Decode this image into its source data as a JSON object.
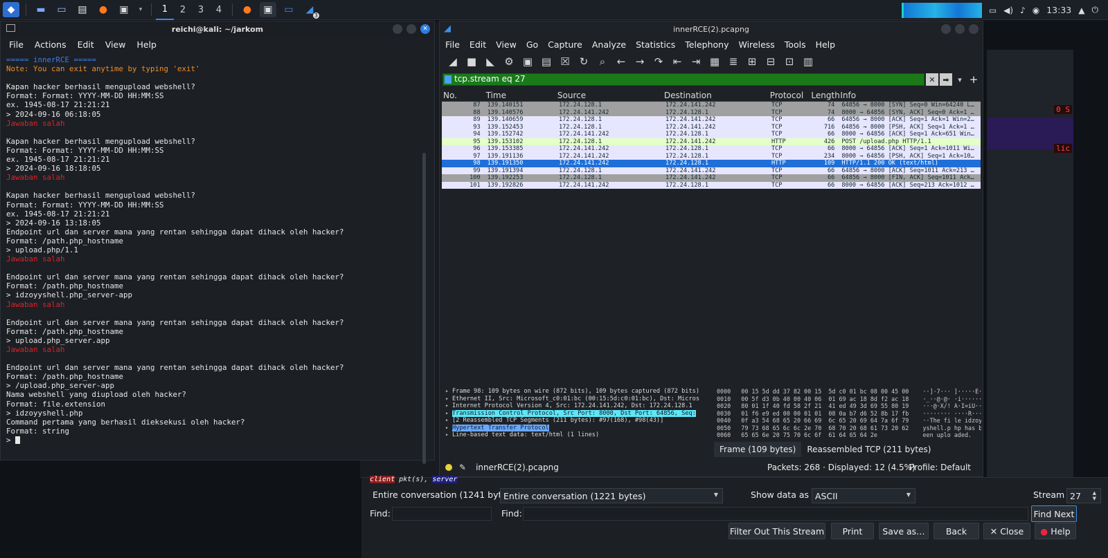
{
  "taskbar": {
    "workspaces": [
      "1",
      "2",
      "3",
      "4"
    ],
    "clock": "13:33",
    "badge": "3"
  },
  "terminal": {
    "title": "reichi@kali: ~/jarkom",
    "menu": [
      "File",
      "Actions",
      "Edit",
      "View",
      "Help"
    ],
    "lines": [
      {
        "t": "===== innerRCE =====",
        "c": "blue"
      },
      {
        "t": "Note: You can exit anytime by typing 'exit'",
        "c": "orange"
      },
      {
        "t": "",
        "c": ""
      },
      {
        "t": "Kapan hacker berhasil mengupload webshell?",
        "c": ""
      },
      {
        "t": "Format: Format: YYYY-MM-DD HH:MM:SS",
        "c": ""
      },
      {
        "t": "ex. 1945-08-17 21:21:21",
        "c": ""
      },
      {
        "t": "> 2024-09-16 06:18:05",
        "c": ""
      },
      {
        "t": "Jawaban salah",
        "c": "red"
      },
      {
        "t": "",
        "c": ""
      },
      {
        "t": "Kapan hacker berhasil mengupload webshell?",
        "c": ""
      },
      {
        "t": "Format: Format: YYYY-MM-DD HH:MM:SS",
        "c": ""
      },
      {
        "t": "ex. 1945-08-17 21:21:21",
        "c": ""
      },
      {
        "t": "> 2024-09-16 18:18:05",
        "c": ""
      },
      {
        "t": "Jawaban salah",
        "c": "red"
      },
      {
        "t": "",
        "c": ""
      },
      {
        "t": "Kapan hacker berhasil mengupload webshell?",
        "c": ""
      },
      {
        "t": "Format: Format: YYYY-MM-DD HH:MM:SS",
        "c": ""
      },
      {
        "t": "ex. 1945-08-17 21:21:21",
        "c": ""
      },
      {
        "t": "> 2024-09-16 13:18:05",
        "c": ""
      },
      {
        "t": "Endpoint url dan server mana yang rentan sehingga dapat dihack oleh hacker?",
        "c": ""
      },
      {
        "t": "Format: /path.php_hostname",
        "c": ""
      },
      {
        "t": "> upload.php/1.1",
        "c": ""
      },
      {
        "t": "Jawaban salah",
        "c": "red"
      },
      {
        "t": "",
        "c": ""
      },
      {
        "t": "Endpoint url dan server mana yang rentan sehingga dapat dihack oleh hacker?",
        "c": ""
      },
      {
        "t": "Format: /path.php_hostname",
        "c": ""
      },
      {
        "t": "> idzoyyshell.php_server-app",
        "c": ""
      },
      {
        "t": "Jawaban salah",
        "c": "red"
      },
      {
        "t": "",
        "c": ""
      },
      {
        "t": "Endpoint url dan server mana yang rentan sehingga dapat dihack oleh hacker?",
        "c": ""
      },
      {
        "t": "Format: /path.php_hostname",
        "c": ""
      },
      {
        "t": "> upload.php_server.app",
        "c": ""
      },
      {
        "t": "Jawaban salah",
        "c": "red"
      },
      {
        "t": "",
        "c": ""
      },
      {
        "t": "Endpoint url dan server mana yang rentan sehingga dapat dihack oleh hacker?",
        "c": ""
      },
      {
        "t": "Format: /path.php_hostname",
        "c": ""
      },
      {
        "t": "> /upload.php_server-app",
        "c": ""
      },
      {
        "t": "Nama webshell yang diupload oleh hacker?",
        "c": ""
      },
      {
        "t": "Format: file.extension",
        "c": ""
      },
      {
        "t": "> idzoyyshell.php",
        "c": ""
      },
      {
        "t": "Command pertama yang berhasil dieksekusi oleh hacker?",
        "c": ""
      },
      {
        "t": "Format: string",
        "c": ""
      }
    ],
    "prompt": "> "
  },
  "wireshark": {
    "title": "innerRCE(2).pcapng",
    "menu": [
      "File",
      "Edit",
      "View",
      "Go",
      "Capture",
      "Analyze",
      "Statistics",
      "Telephony",
      "Wireless",
      "Tools",
      "Help"
    ],
    "filter": "tcp.stream eq 27",
    "columns": [
      "No.",
      "Time",
      "Source",
      "Destination",
      "Protocol",
      "Length",
      "Info"
    ],
    "packets": [
      {
        "no": "87",
        "time": "139.140151",
        "src": "172.24.128.1",
        "dst": "172.24.141.242",
        "proto": "TCP",
        "len": "74",
        "info": "64856 → 8000 [SYN] Seq=0 Win=64240 L…",
        "bg": "#a0a0a0",
        "fg": "#12272e"
      },
      {
        "no": "88",
        "time": "139.140576",
        "src": "172.24.141.242",
        "dst": "172.24.128.1",
        "proto": "TCP",
        "len": "74",
        "info": "8000 → 64856 [SYN, ACK] Seq=0 Ack=1 …",
        "bg": "#a0a0a0",
        "fg": "#12272e"
      },
      {
        "no": "89",
        "time": "139.140659",
        "src": "172.24.128.1",
        "dst": "172.24.141.242",
        "proto": "TCP",
        "len": "66",
        "info": "64856 → 8000 [ACK] Seq=1 Ack=1 Win=2…",
        "bg": "#e7e6ff",
        "fg": "#12272e"
      },
      {
        "no": "93",
        "time": "139.152453",
        "src": "172.24.128.1",
        "dst": "172.24.141.242",
        "proto": "TCP",
        "len": "716",
        "info": "64856 → 8000 [PSH, ACK] Seq=1 Ack=1 …",
        "bg": "#e7e6ff",
        "fg": "#12272e"
      },
      {
        "no": "94",
        "time": "139.152742",
        "src": "172.24.141.242",
        "dst": "172.24.128.1",
        "proto": "TCP",
        "len": "66",
        "info": "8000 → 64856 [ACK] Seq=1 Ack=651 Win…",
        "bg": "#e7e6ff",
        "fg": "#12272e"
      },
      {
        "no": "95",
        "time": "139.153102",
        "src": "172.24.128.1",
        "dst": "172.24.141.242",
        "proto": "HTTP",
        "len": "426",
        "info": "POST /upload.php HTTP/1.1",
        "bg": "#e4ffc7",
        "fg": "#12272e"
      },
      {
        "no": "96",
        "time": "139.153385",
        "src": "172.24.141.242",
        "dst": "172.24.128.1",
        "proto": "TCP",
        "len": "66",
        "info": "8000 → 64856 [ACK] Seq=1 Ack=1011 Wi…",
        "bg": "#e7e6ff",
        "fg": "#12272e"
      },
      {
        "no": "97",
        "time": "139.191136",
        "src": "172.24.141.242",
        "dst": "172.24.128.1",
        "proto": "TCP",
        "len": "234",
        "info": "8000 → 64856 [PSH, ACK] Seq=1 Ack=10…",
        "bg": "#e7e6ff",
        "fg": "#12272e"
      },
      {
        "no": "98",
        "time": "139.191350",
        "src": "172.24.141.242",
        "dst": "172.24.128.1",
        "proto": "HTTP",
        "len": "109",
        "info": "HTTP/1.1 200 OK  (text/html)",
        "bg": "#1e6fd9",
        "fg": "#ffffff"
      },
      {
        "no": "99",
        "time": "139.191394",
        "src": "172.24.128.1",
        "dst": "172.24.141.242",
        "proto": "TCP",
        "len": "66",
        "info": "64856 → 8000 [ACK] Seq=1011 Ack=213 …",
        "bg": "#e7e6ff",
        "fg": "#12272e"
      },
      {
        "no": "100",
        "time": "139.192253",
        "src": "172.24.128.1",
        "dst": "172.24.141.242",
        "proto": "TCP",
        "len": "66",
        "info": "64856 → 8000 [FIN, ACK] Seq=1011 Ack…",
        "bg": "#a0a0a0",
        "fg": "#12272e"
      },
      {
        "no": "101",
        "time": "139.192826",
        "src": "172.24.141.242",
        "dst": "172.24.128.1",
        "proto": "TCP",
        "len": "66",
        "info": "8000 → 64856 [ACK] Seq=213 Ack=1012 …",
        "bg": "#e7e6ff",
        "fg": "#12272e"
      }
    ],
    "details": [
      {
        "t": "Frame 98: 109 bytes on wire (872 bits), 109 bytes captured (872 bits)",
        "hl": ""
      },
      {
        "t": "Ethernet II, Src: Microsoft_c0:01:bc (00:15:5d:c0:01:bc), Dst: Micros",
        "hl": ""
      },
      {
        "t": "Internet Protocol Version 4, Src: 172.24.141.242, Dst: 172.24.128.1",
        "hl": ""
      },
      {
        "t": "Transmission Control Protocol, Src Port: 8000, Dst Port: 64856, Seq:",
        "hl": "cyan"
      },
      {
        "t": "[2 Reassembled TCP Segments (211 bytes): #97(168), #98(43)]",
        "hl": ""
      },
      {
        "t": "Hypertext Transfer Protocol",
        "hl": "blue"
      },
      {
        "t": "Line-based text data: text/html (1 lines)",
        "hl": ""
      }
    ],
    "hex": [
      "0000   00 15 5d dd 37 82 00 15  5d c0 01 bc 08 00 45 00    ··]·7··· ]·····E·",
      "0010   00 5f d3 0b 40 00 40 06  01 69 ac 18 8d f2 ac 18    ·_··@·@· ·i······",
      "0020   80 01 1f 40 fd 58 2f 21  41 ed 49 3d 69 55 80 19    ···@·X/! A·I=iU··",
      "0030   01 f6 e9 ed 00 00 01 01  08 0a b7 d6 52 8b 17 fb    ········ ····R···",
      "0040   0f a3 54 68 65 20 66 69  6c 65 20 69 64 7a 6f 79    ··The fi le idzoy",
      "0050   79 73 68 65 6c 6c 2e 70  68 70 20 68 61 73 20 62    yshell.p hp has b",
      "0060   65 65 6e 20 75 70 6c 6f  61 64 65 64 2e             een uplo aded."
    ],
    "bytes_tabs": [
      "Frame (109 bytes)",
      "Reassembled TCP (211 bytes)"
    ],
    "status": {
      "file": "innerRCE(2).pcapng",
      "packets": "Packets: 268 · Displayed: 12 (4.5%)",
      "profile": "Profile: Default"
    }
  },
  "follow": {
    "pkts_label_client": "client",
    "pkts_label_mid": " pkt(s), ",
    "pkts_label_server": "server",
    "conv_left": "Entire conversation (1241 bytes)",
    "conv_select": "Entire conversation (1221 bytes)",
    "show_label": "Show data as",
    "show_value": "ASCII",
    "stream_label": "Stream",
    "stream_value": "27",
    "find_label": "Find:",
    "find_next": "Find Next",
    "buttons": {
      "filter_out": "Filter Out This Stream",
      "print": "Print",
      "save_as": "Save as…",
      "back": "Back",
      "close": "✕ Close",
      "help": "Help"
    }
  },
  "firefox_bg": {
    "tag1": "0 S",
    "tag2": "lic"
  }
}
